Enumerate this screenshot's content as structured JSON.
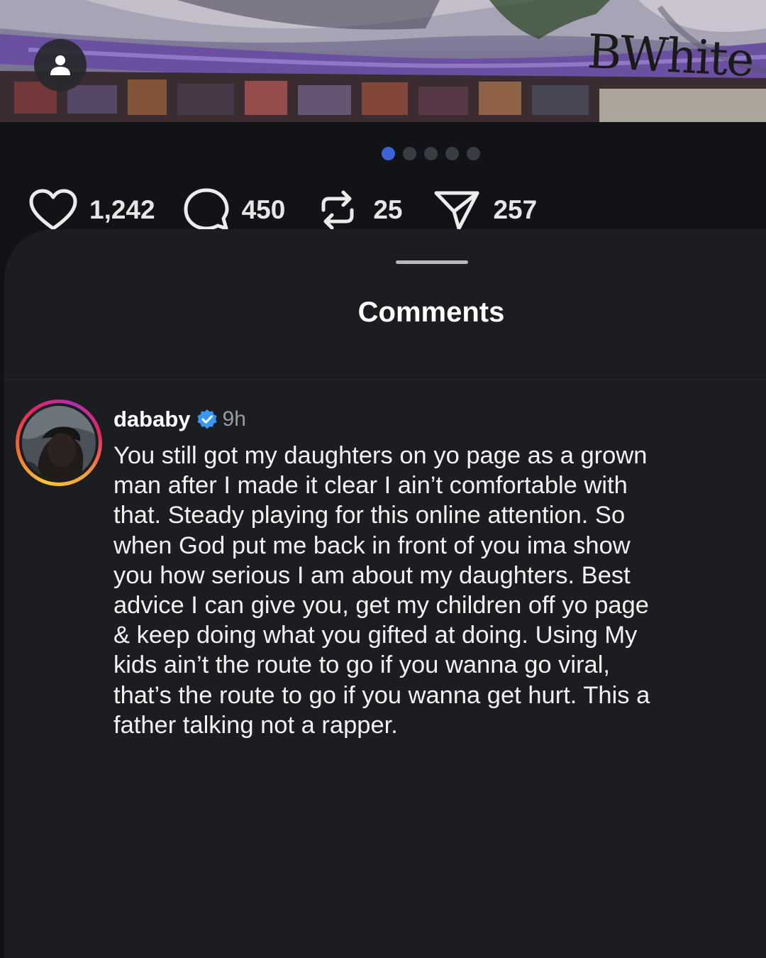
{
  "post": {
    "image_signature": "BWhite",
    "carousel": {
      "total": 5,
      "active_index": 1
    }
  },
  "actions": {
    "likes": {
      "icon": "heart-icon",
      "count": "1,242"
    },
    "comments": {
      "icon": "comment-icon",
      "count": "450"
    },
    "reposts": {
      "icon": "repost-icon",
      "count": "25"
    },
    "shares": {
      "icon": "send-icon",
      "count": "257"
    }
  },
  "comments_sheet": {
    "title": "Comments",
    "items": [
      {
        "username": "dababy",
        "verified": true,
        "time": "9h",
        "text": "You still got my daughters on yo page as a grown\nman after I made it clear I ain’t comfortable with\nthat.  Steady playing for this online attention. So\nwhen God put me back in front of you ima show\nyou how serious I am about my daughters. Best\nadvice I can give you, get my children off yo page\n& keep doing what you gifted at doing. Using My\nkids ain’t the  route to go if you wanna go viral,\nthat’s the route to go if you wanna get hurt. This a\nfather talking not a rapper."
      }
    ]
  },
  "colors": {
    "background": "#111215",
    "sheet": "#1c1d21",
    "carousel_active": "#3d63d6",
    "verified_badge": "#3897f0"
  }
}
